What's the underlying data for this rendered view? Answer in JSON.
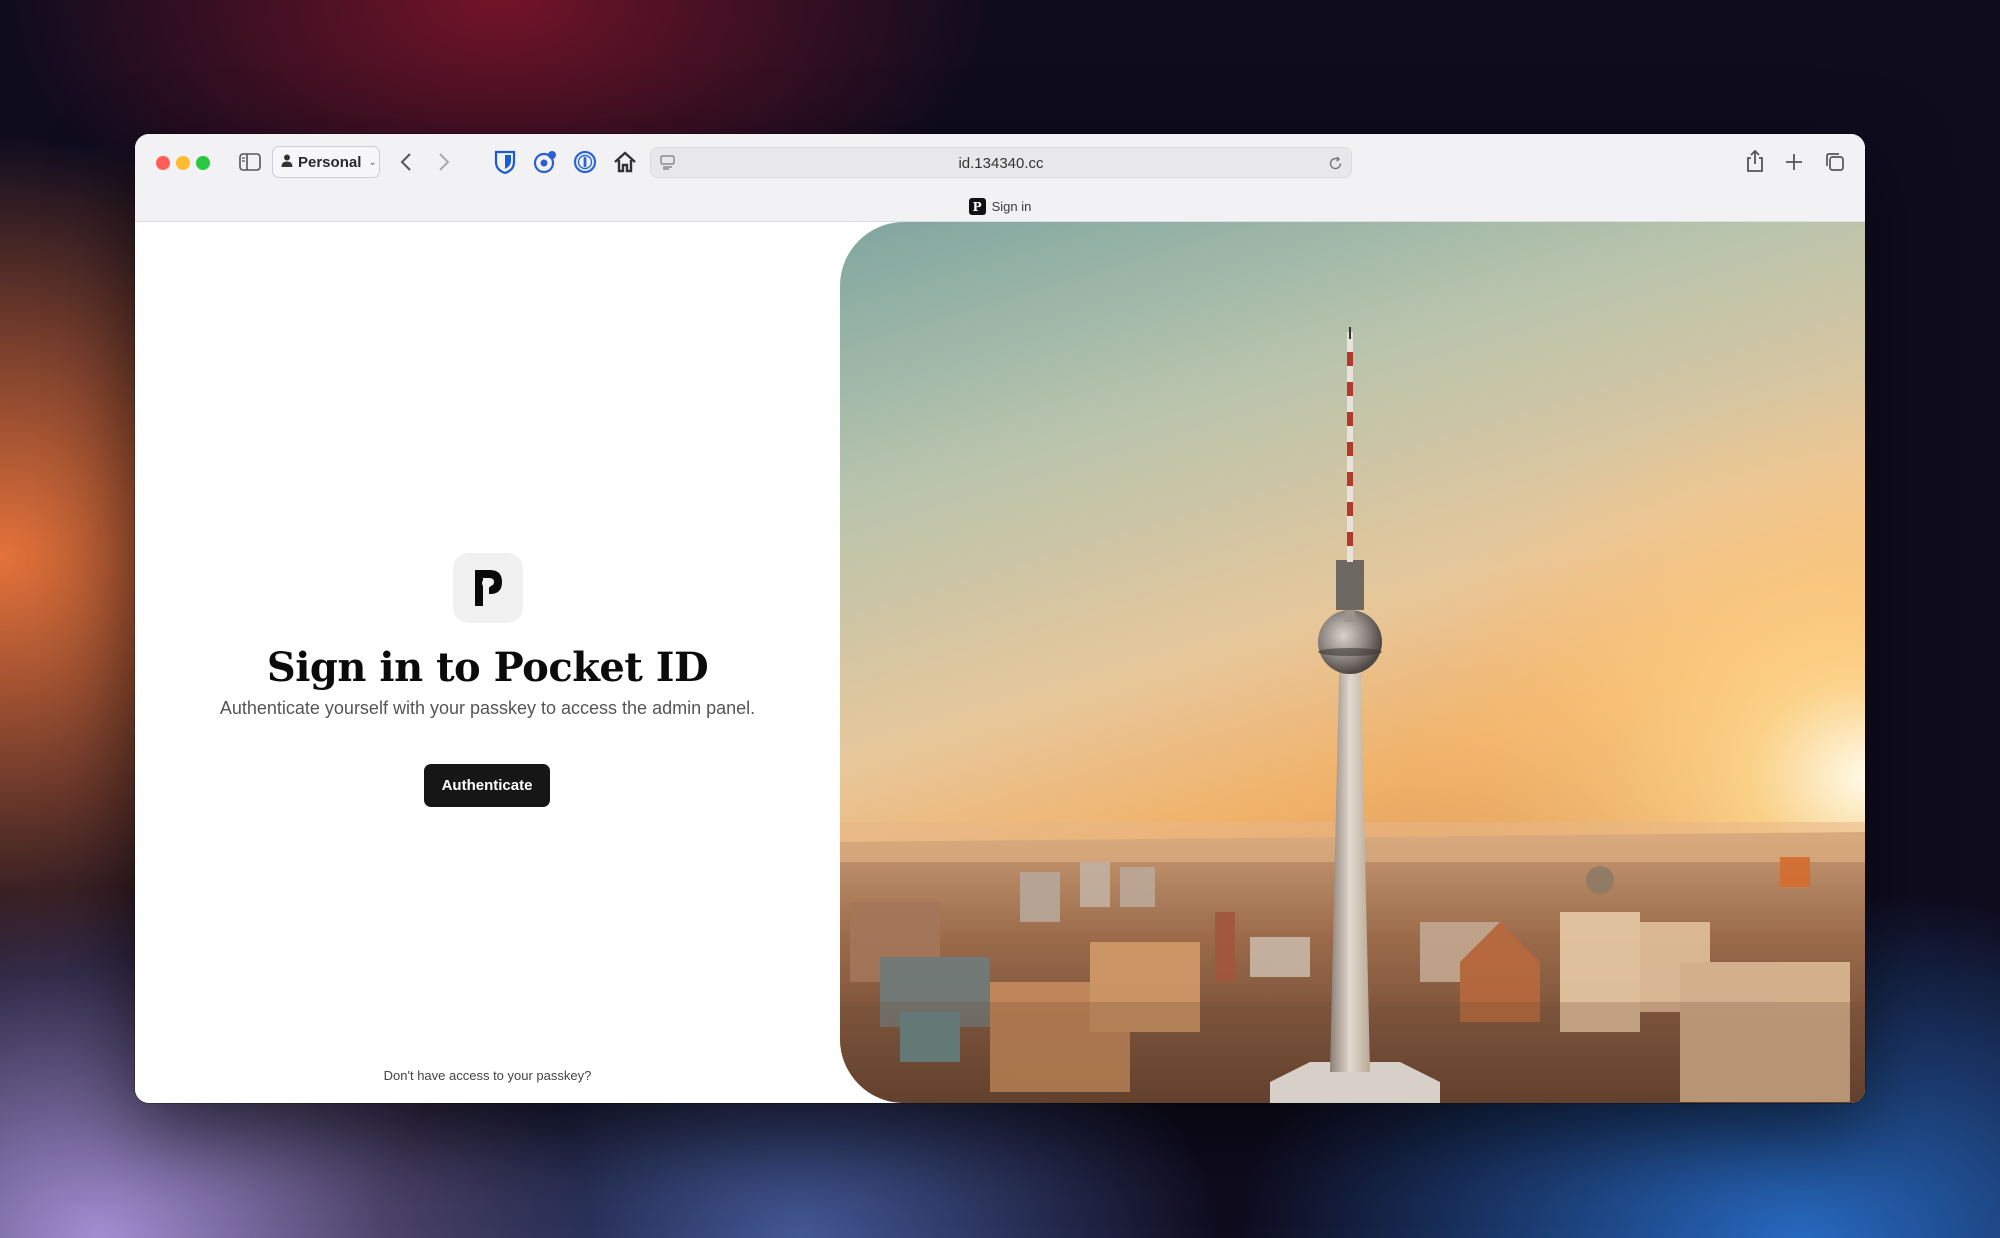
{
  "browser": {
    "profile_label": "Personal",
    "url": "id.134340.cc",
    "tab_title": "Sign in",
    "tab_favicon_letter": "P"
  },
  "page": {
    "logo_letter": "P",
    "headline": "Sign in to Pocket ID",
    "subtitle": "Authenticate yourself with your passkey to access the admin panel.",
    "authenticate_label": "Authenticate",
    "footer_link": "Don't have access to your passkey?"
  },
  "icons": {
    "sidebar": "sidebar-toggle-icon",
    "profile": "person-icon",
    "back": "chevron-left-icon",
    "forward": "chevron-right-icon",
    "ext1": "bitwarden-shield-icon",
    "ext2": "privacy-extension-icon",
    "ext3": "1password-icon",
    "ext4": "home-extension-icon",
    "site_settings": "page-settings-icon",
    "reload": "reload-icon",
    "share": "share-icon",
    "new_tab": "plus-icon",
    "tabs_overview": "tabs-overview-icon"
  },
  "colors": {
    "button_bg": "#161616",
    "traffic_red": "#ff5f57",
    "traffic_yellow": "#febc2e",
    "traffic_green": "#28c840"
  }
}
